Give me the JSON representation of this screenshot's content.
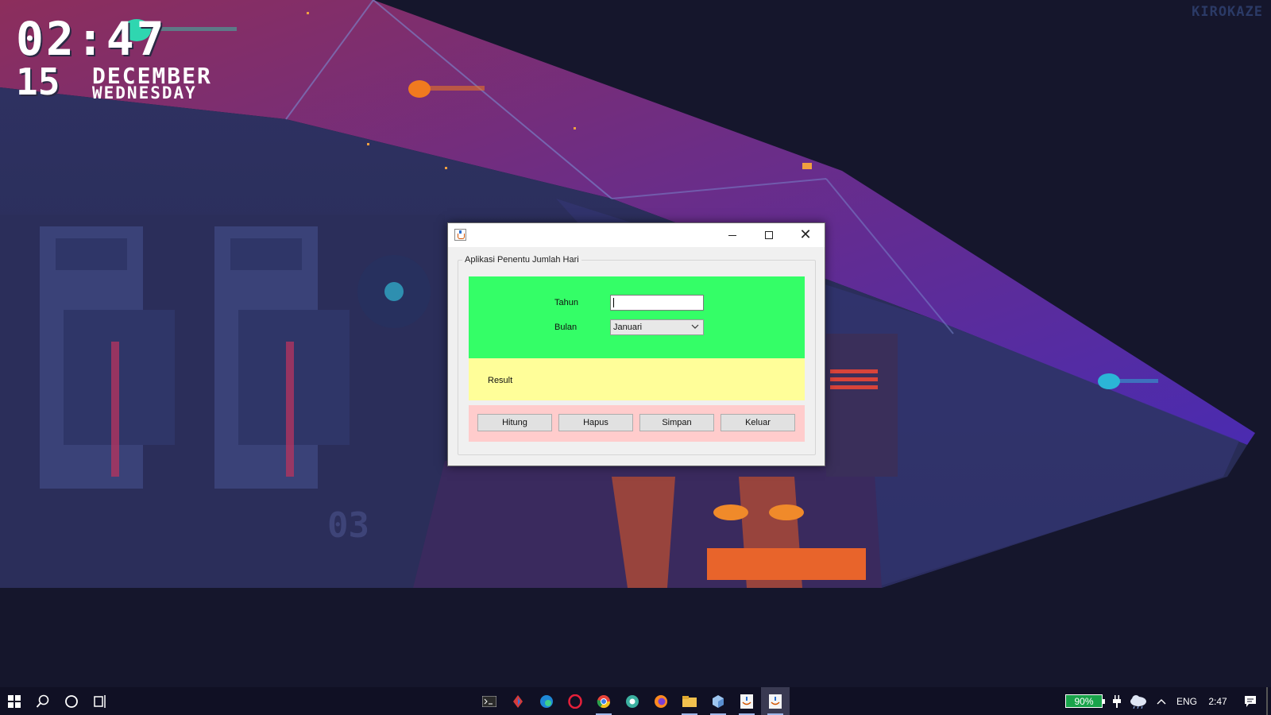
{
  "desktop": {
    "clock": {
      "time": "02:47",
      "day": "15",
      "month": "DECEMBER",
      "weekday": "WEDNESDAY"
    },
    "watermark": "KIROKAZE"
  },
  "window": {
    "title": "",
    "controls": {
      "minimize": "minimize",
      "maximize": "maximize",
      "close": "close"
    },
    "group_title": "Aplikasi Penentu Jumlah Hari",
    "form": {
      "tahun_label": "Tahun",
      "tahun_value": "",
      "bulan_label": "Bulan",
      "bulan_selected": "Januari"
    },
    "result_label": "Result",
    "buttons": {
      "hitung": "Hitung",
      "hapus": "Hapus",
      "simpan": "Simpan",
      "keluar": "Keluar"
    },
    "colors": {
      "input_panel": "#34fe67",
      "result_panel": "#fffe99",
      "button_panel": "#ffcccc"
    }
  },
  "taskbar": {
    "pinned": [
      "terminal-icon",
      "app-red-icon",
      "edge-icon",
      "opera-icon",
      "chrome-icon",
      "chrome-canary-icon",
      "firefox-icon",
      "file-explorer-icon",
      "box-app-icon",
      "java-app-icon",
      "java-app-active-icon"
    ],
    "tray": {
      "battery": "90%",
      "language": "ENG",
      "time": "2:47"
    }
  }
}
